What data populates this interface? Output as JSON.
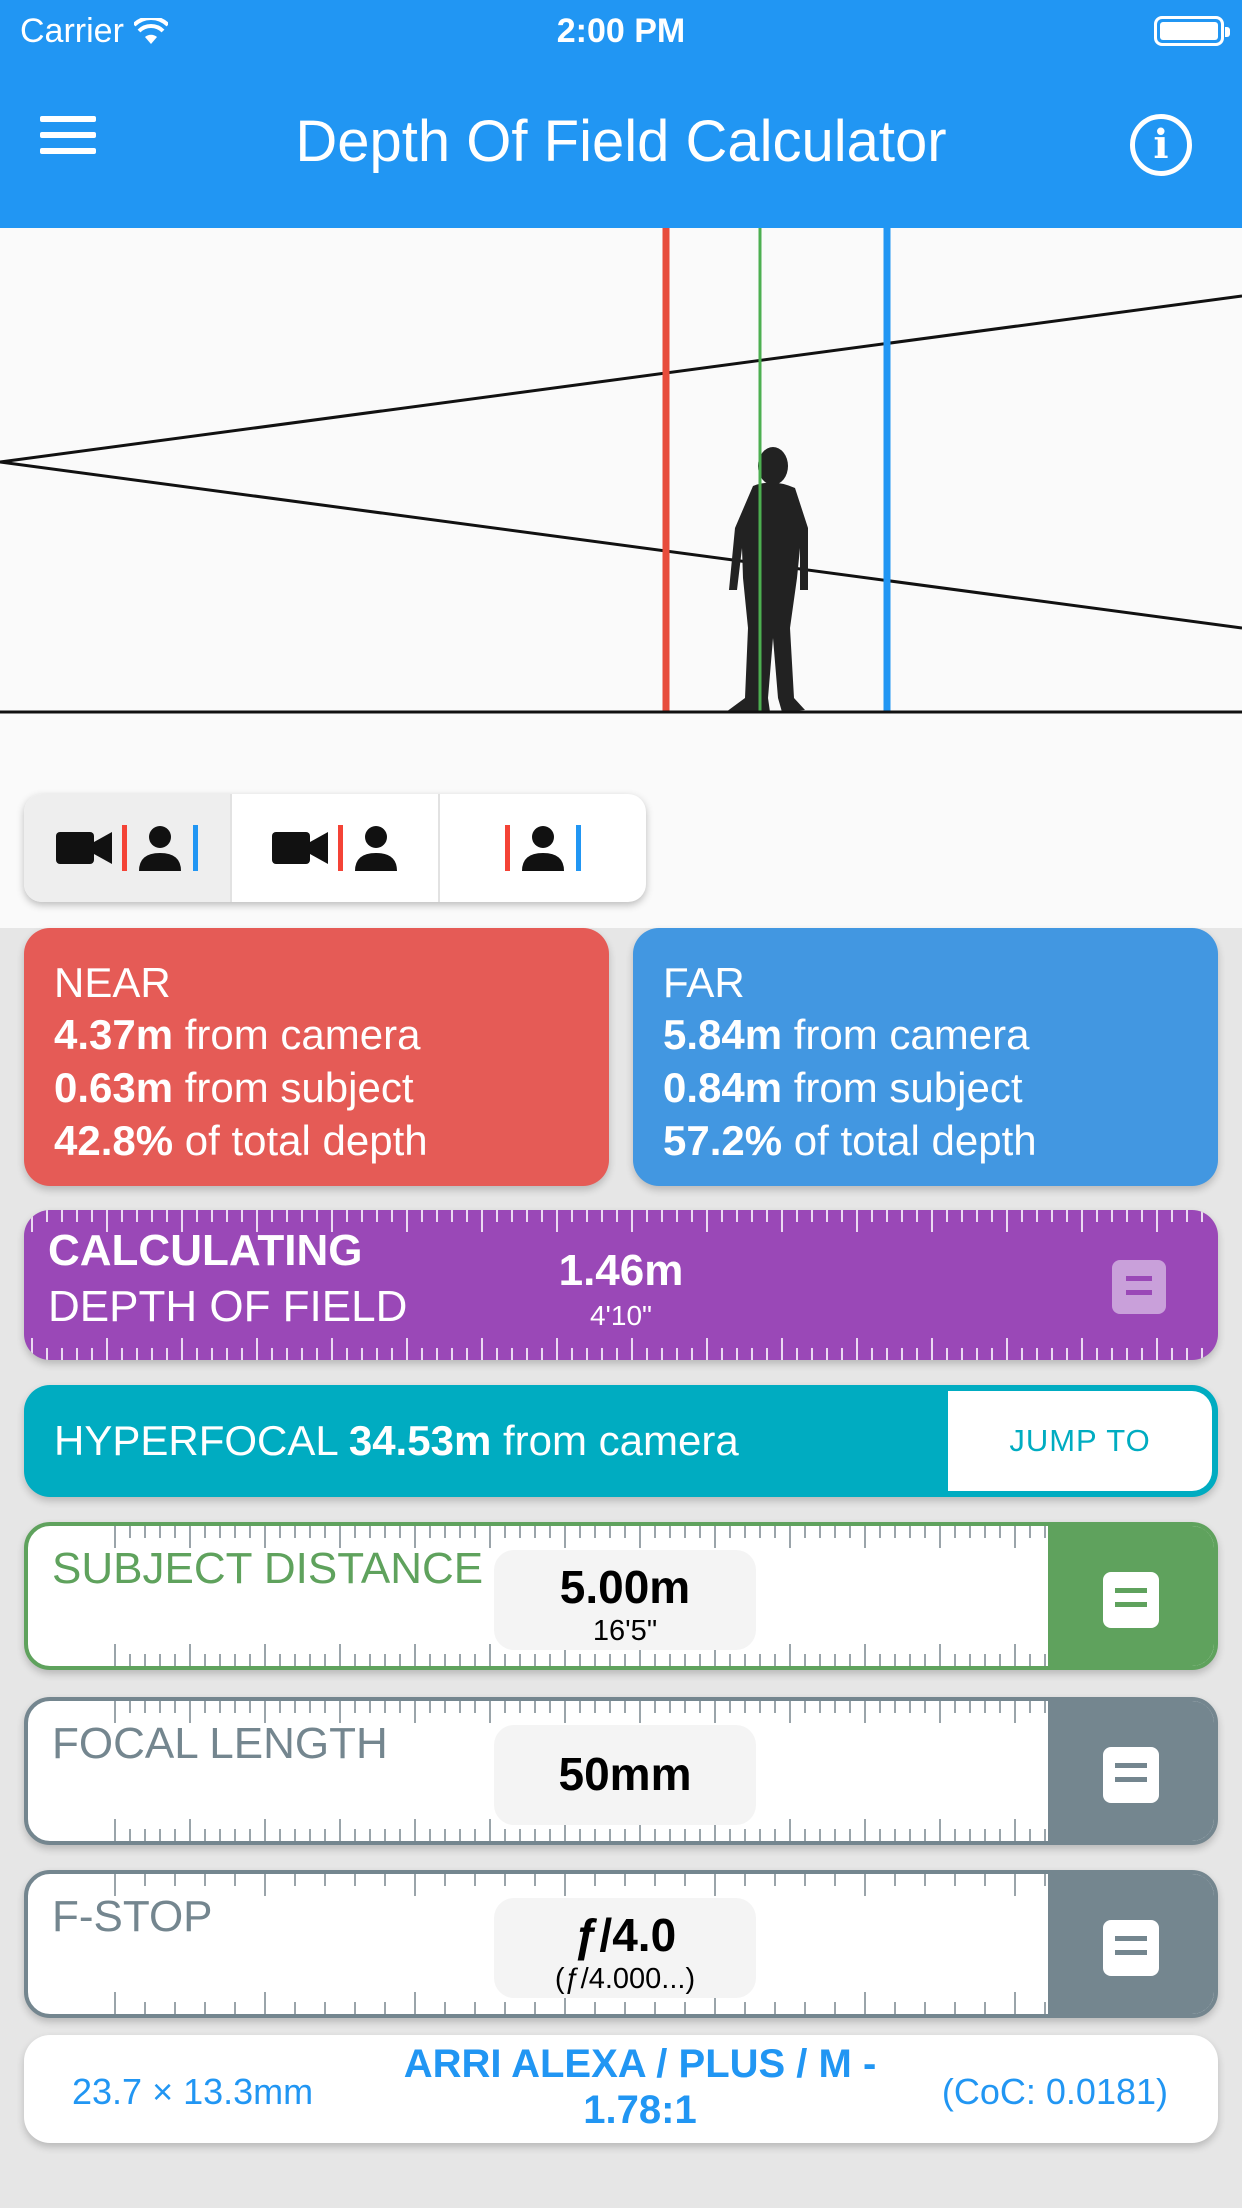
{
  "status_bar": {
    "carrier": "Carrier",
    "time": "2:00 PM"
  },
  "app_bar": {
    "title": "Depth Of Field Calculator"
  },
  "view_modes": [
    {
      "label": "camera-near-subject-far",
      "active": true
    },
    {
      "label": "camera-near-subject",
      "active": false
    },
    {
      "label": "near-subject-far",
      "active": false
    }
  ],
  "near": {
    "heading": "NEAR",
    "from_camera_value": "4.37m",
    "from_camera_text": " from camera",
    "from_subject_value": "0.63m",
    "from_subject_text": " from subject",
    "depth_value": "42.8%",
    "depth_text": " of total depth"
  },
  "far": {
    "heading": "FAR",
    "from_camera_value": "5.84m",
    "from_camera_text": " from camera",
    "from_subject_value": "0.84m",
    "from_subject_text": " from subject",
    "depth_value": "57.2%",
    "depth_text": " of total depth"
  },
  "dof": {
    "label_line1": "CALCULATING",
    "label_line2": "DEPTH OF FIELD",
    "value": "1.46m",
    "imperial": "4'10\""
  },
  "hyperfocal": {
    "label": "HYPERFOCAL ",
    "value": "34.53m",
    "suffix": " from camera",
    "jump_label": "JUMP TO"
  },
  "subject_distance": {
    "label": "SUBJECT DISTANCE",
    "value": "5.00m",
    "imperial": "16'5\""
  },
  "focal_length": {
    "label": "FOCAL LENGTH",
    "value": "50mm"
  },
  "f_stop": {
    "label": "F-STOP",
    "value": "ƒ/4.0",
    "precise": "(ƒ/4.000...)"
  },
  "sensor": {
    "dimensions": "23.7 × 13.3mm",
    "name": "ARRI ALEXA / PLUS / M - 1.78:1",
    "coc": "(CoC: 0.0181)"
  },
  "colors": {
    "app_bar": "#2196f3",
    "near": "#e55b56",
    "far": "#4297e1",
    "dof": "#9a48b7",
    "hyperfocal": "#00acc1",
    "subject": "#5fa25d",
    "neutral": "#74868f"
  }
}
